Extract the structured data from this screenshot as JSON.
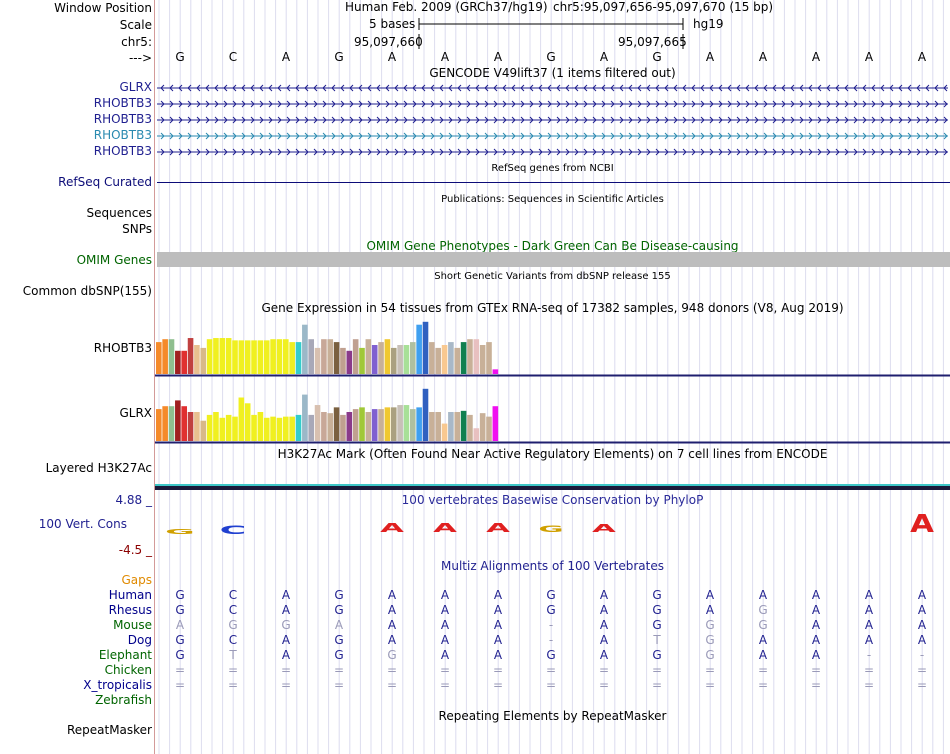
{
  "position_header": {
    "window_position_label": "Window Position",
    "scale_label": "Scale",
    "chrom_label": "chr5:",
    "strand_label": "--->",
    "assembly_text": "Human Feb. 2009 (GRCh37/hg19)",
    "position_text": "chr5:95,097,656-95,097,670 (15 bp)",
    "scale_text": "5 bases",
    "db_text": "hg19",
    "coord_left": "95,097,660",
    "coord_right": "95,097,665"
  },
  "bases": [
    "G",
    "C",
    "A",
    "G",
    "A",
    "A",
    "A",
    "G",
    "A",
    "G",
    "A",
    "A",
    "A",
    "A",
    "A"
  ],
  "gencode": {
    "title": "GENCODE V49lift37 (1 items filtered out)",
    "genes": [
      {
        "label": "GLRX",
        "strand": "-",
        "color": "#1f1f8f"
      },
      {
        "label": "RHOBTB3",
        "strand": "+",
        "color": "#1f1f8f"
      },
      {
        "label": "RHOBTB3",
        "strand": "+",
        "color": "#1f1f8f"
      },
      {
        "label": "RHOBTB3",
        "strand": "+",
        "color": "#2a8ab0"
      },
      {
        "label": "RHOBTB3",
        "strand": "+",
        "color": "#1f1f8f"
      }
    ]
  },
  "refseq": {
    "title": "RefSeq genes from NCBI",
    "label": "RefSeq Curated",
    "color": "#0c0c78"
  },
  "publications": {
    "title": "Publications: Sequences in Scientific Articles",
    "label_sequences": "Sequences",
    "label_snps": "SNPs"
  },
  "omim": {
    "title": "OMIM Gene Phenotypes - Dark Green Can Be Disease-causing",
    "label": "OMIM Genes",
    "color": "#006400"
  },
  "dbsnp": {
    "title": "Short Genetic Variants from dbSNP release 155",
    "label": "Common dbSNP(155)"
  },
  "gtex": {
    "title": "Gene Expression in 54 tissues from GTEx RNA-seq of 17382 samples, 948 donors (V8, Aug 2019)",
    "genes": [
      {
        "label": "RHOBTB3",
        "levels": [
          0.55,
          0.6,
          0.6,
          0.4,
          0.4,
          0.62,
          0.5,
          0.45,
          0.6,
          0.62,
          0.62,
          0.62,
          0.58,
          0.58,
          0.58,
          0.58,
          0.58,
          0.58,
          0.6,
          0.6,
          0.6,
          0.55,
          0.55,
          0.85,
          0.6,
          0.45,
          0.6,
          0.6,
          0.55,
          0.45,
          0.4,
          0.6,
          0.45,
          0.6,
          0.5,
          0.55,
          0.6,
          0.45,
          0.5,
          0.5,
          0.55,
          0.85,
          0.9,
          0.55,
          0.45,
          0.5,
          0.55,
          0.45,
          0.55,
          0.6,
          0.6,
          0.5,
          0.55,
          0.08
        ]
      },
      {
        "label": "GLRX",
        "levels": [
          0.55,
          0.6,
          0.6,
          0.7,
          0.6,
          0.5,
          0.5,
          0.35,
          0.45,
          0.5,
          0.4,
          0.45,
          0.42,
          0.75,
          0.65,
          0.45,
          0.5,
          0.4,
          0.42,
          0.4,
          0.42,
          0.42,
          0.45,
          0.8,
          0.45,
          0.62,
          0.5,
          0.48,
          0.58,
          0.45,
          0.5,
          0.55,
          0.58,
          0.5,
          0.55,
          0.55,
          0.58,
          0.58,
          0.62,
          0.62,
          0.55,
          0.58,
          0.9,
          0.5,
          0.5,
          0.3,
          0.5,
          0.5,
          0.52,
          0.45,
          0.22,
          0.48,
          0.42,
          0.6
        ]
      }
    ]
  },
  "h3k27ac": {
    "title": "H3K27Ac Mark (Often Found Near Active Regulatory Elements) on 7 cell lines from ENCODE",
    "label": "Layered H3K27Ac"
  },
  "conservation": {
    "title": "100 vertebrates Basewise Conservation by PhyloP",
    "label": "100 Vert. Cons",
    "max_label": "4.88 _",
    "min_label": "-4.5 _",
    "scores": [
      -0.5,
      -0.8,
      0,
      0,
      0.6,
      0.6,
      0.6,
      0.4,
      0.5,
      0,
      0,
      0,
      0,
      0,
      1.2
    ]
  },
  "multiz": {
    "title": "Multiz Alignments of 100 Vertebrates",
    "gaps_label": "Gaps",
    "species": [
      {
        "name": "Human",
        "color": "#00008b",
        "seq": [
          "G",
          "C",
          "A",
          "G",
          "A",
          "A",
          "A",
          "G",
          "A",
          "G",
          "A",
          "A",
          "A",
          "A",
          "A"
        ]
      },
      {
        "name": "Rhesus",
        "color": "#00008b",
        "seq": [
          "G",
          "C",
          "A",
          "G",
          "A",
          "A",
          "A",
          "G",
          "A",
          "G",
          "A",
          "G",
          "A",
          "A",
          "A"
        ]
      },
      {
        "name": "Mouse",
        "color": "#006400",
        "seq": [
          "A",
          "G",
          "G",
          "A",
          "A",
          "A",
          "A",
          "-",
          "A",
          "G",
          "G",
          "G",
          "A",
          "A",
          "A"
        ]
      },
      {
        "name": "Dog",
        "color": "#00008b",
        "seq": [
          "G",
          "C",
          "A",
          "G",
          "A",
          "A",
          "A",
          "-",
          "A",
          "T",
          "G",
          "A",
          "A",
          "A",
          "A"
        ]
      },
      {
        "name": "Elephant",
        "color": "#006400",
        "seq": [
          "G",
          "T",
          "A",
          "G",
          "G",
          "A",
          "A",
          "G",
          "A",
          "G",
          "G",
          "A",
          "A",
          "-",
          "-"
        ]
      },
      {
        "name": "Chicken",
        "color": "#006400",
        "seq": [
          "=",
          "=",
          "=",
          "=",
          "=",
          "=",
          "=",
          "=",
          "=",
          "=",
          "=",
          "=",
          "=",
          "=",
          "="
        ]
      },
      {
        "name": "X_tropicalis",
        "color": "#00008b",
        "seq": [
          "=",
          "=",
          "=",
          "=",
          "=",
          "=",
          "=",
          "=",
          "=",
          "=",
          "=",
          "=",
          "=",
          "=",
          "="
        ]
      },
      {
        "name": "Zebrafish",
        "color": "#006400",
        "seq": []
      }
    ]
  },
  "repeatmasker": {
    "title": "Repeating Elements by RepeatMasker",
    "label": "RepeatMasker"
  }
}
